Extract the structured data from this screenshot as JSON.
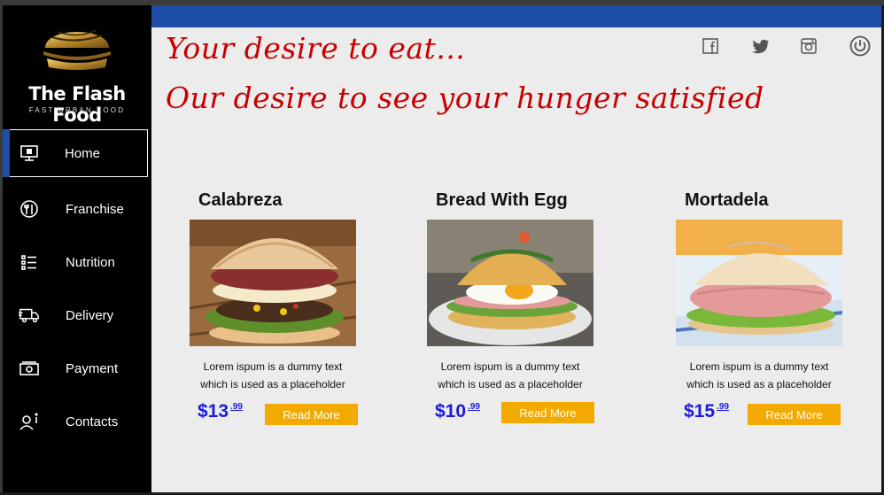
{
  "brand": {
    "name": "The Flash Food",
    "tagline": "FAST URBAN FOOD"
  },
  "nav": {
    "items": [
      {
        "label": "Home",
        "icon": "monitor-icon",
        "active": true
      },
      {
        "label": "Franchise",
        "icon": "dining-icon"
      },
      {
        "label": "Nutrition",
        "icon": "list-icon"
      },
      {
        "label": "Delivery",
        "icon": "truck-icon"
      },
      {
        "label": "Payment",
        "icon": "money-icon"
      },
      {
        "label": "Contacts",
        "icon": "contact-icon"
      }
    ]
  },
  "header": {
    "line1": "Your desire to eat...",
    "line2": "Our desire to see your hunger satisfied",
    "icons": [
      "facebook-icon",
      "twitter-icon",
      "instagram-icon",
      "power-icon"
    ]
  },
  "products": [
    {
      "name": "Calabreza",
      "desc_line1": "Lorem ispum is a dummy text",
      "desc_line2": "which is used as a placeholder",
      "price": "$13",
      "cents": ".99",
      "button": "Read More"
    },
    {
      "name": "Bread With Egg",
      "desc_line1": "Lorem ispum is a dummy text",
      "desc_line2": "which is used as a placeholder",
      "price": "$10",
      "cents": ".99",
      "button": "Read More"
    },
    {
      "name": "Mortadela",
      "desc_line1": "Lorem ispum is a dummy text",
      "desc_line2": "which is used as a placeholder",
      "price": "$15",
      "cents": ".99",
      "button": "Read More"
    }
  ],
  "colors": {
    "accent": "#1f4ea8",
    "tagline": "#c80000",
    "price": "#1a1ae0",
    "button": "#f2a900",
    "sidebar": "#000000",
    "background": "#ececec"
  }
}
